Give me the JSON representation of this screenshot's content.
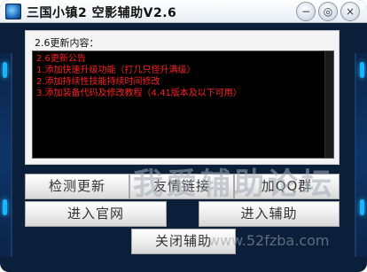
{
  "window": {
    "title": "三国小镇2 空影辅助V2.6",
    "accent": "#0b1f3a",
    "glow_color": "#19b6ff"
  },
  "titlebar_buttons": {
    "minimize_label": "−",
    "settings_label": "◎",
    "close_label": "×"
  },
  "panel": {
    "heading": "2.6更新内容：",
    "text_color": "#ff2020",
    "lines": [
      "2.6更新公告",
      "1.添加快速升级功能（打几只怪升满级）",
      "2.添加持续性技能持续时间修改",
      "3.添加装备代码及修改教程（4.41版本及以下可用）"
    ]
  },
  "buttons": {
    "check_update": "检测更新",
    "friend_links": "友情链接",
    "join_qq_group": "加QQ群",
    "visit_website": "进入官网",
    "enter_assist": "进入辅助",
    "close_assist": "关闭辅助"
  },
  "watermark": {
    "text": "我爱辅助论坛",
    "url": "www.52fzba.com"
  }
}
